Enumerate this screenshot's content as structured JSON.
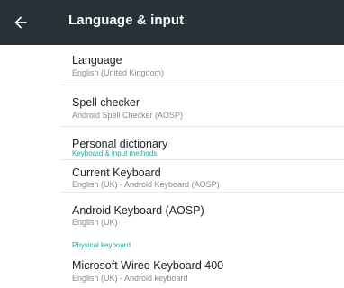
{
  "appbar": {
    "title": "Language & input",
    "back_icon": "arrow-back-icon",
    "background": "#263238"
  },
  "items": {
    "language": {
      "title": "Language",
      "summary": "English (United Kingdom)"
    },
    "spell_checker": {
      "title": "Spell checker",
      "summary": "Android Spell Checker (AOSP)"
    },
    "personal_dictionary": {
      "title": "Personal dictionary"
    },
    "current_keyboard": {
      "title": "Current Keyboard",
      "summary": "English (UK) - Android Keyboard (AOSP)"
    },
    "android_keyboard": {
      "title": "Android Keyboard (AOSP)",
      "summary": "English (UK)"
    },
    "microsoft_keyboard": {
      "title": "Microsoft Wired Keyboard 400",
      "summary": "English (UK) - Android keyboard"
    }
  },
  "sections": {
    "keyboard_input": "Keyboard & input methods",
    "physical_keyboard": "Physical keyboard"
  },
  "colors": {
    "accent": "#26a69a"
  }
}
